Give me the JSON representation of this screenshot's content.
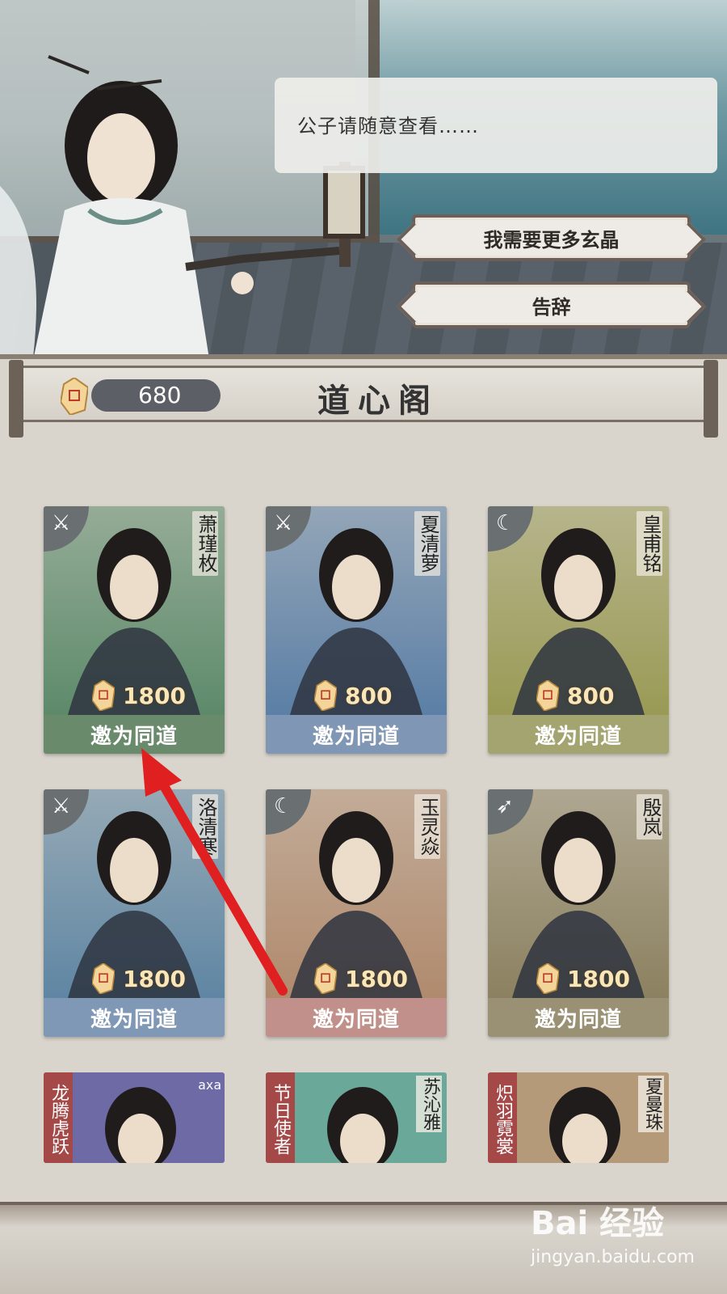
{
  "dialogue": {
    "text": "公子请随意查看……"
  },
  "options": [
    {
      "label": "我需要更多玄晶"
    },
    {
      "label": "告辞"
    }
  ],
  "shop": {
    "title": "道心阁",
    "currency_amount": "680"
  },
  "characters": [
    {
      "name": "萧瑾枚",
      "price": "1800",
      "action": "邀为同道",
      "type_icon": "sword-icon",
      "theme": "#5d8a6a",
      "bar": "#6a8a6c"
    },
    {
      "name": "夏清萝",
      "price": "800",
      "action": "邀为同道",
      "type_icon": "sword-icon",
      "theme": "#5b7fa6",
      "bar": "#7f97b5"
    },
    {
      "name": "皇甫铭",
      "price": "800",
      "action": "邀为同道",
      "type_icon": "moon-icon",
      "theme": "#9a9a56",
      "bar": "#a3a470"
    },
    {
      "name": "洛清寒",
      "price": "1800",
      "action": "邀为同道",
      "type_icon": "sword-icon",
      "theme": "#5f86a3",
      "bar": "#7f98b6"
    },
    {
      "name": "玉灵焱",
      "price": "1800",
      "action": "邀为同道",
      "type_icon": "moon-icon",
      "theme": "#b08a6d",
      "bar": "#c1908a"
    },
    {
      "name": "殷岚",
      "price": "1800",
      "action": "邀为同道",
      "type_icon": "spear-icon",
      "theme": "#8c8160",
      "bar": "#9a9174"
    }
  ],
  "next_row": [
    {
      "tag": "龙腾虎跃",
      "name": "",
      "mark": "axa",
      "theme": "#6d6aa6"
    },
    {
      "tag": "节日使者",
      "name": "苏沁雅",
      "mark": "",
      "theme": "#6aa89a"
    },
    {
      "tag": "炽羽霓裳",
      "name": "夏曼珠",
      "mark": "",
      "theme": "#b59a7a"
    }
  ],
  "watermark": {
    "brand": "Bai 经验",
    "url": "jingyan.baidu.com"
  }
}
